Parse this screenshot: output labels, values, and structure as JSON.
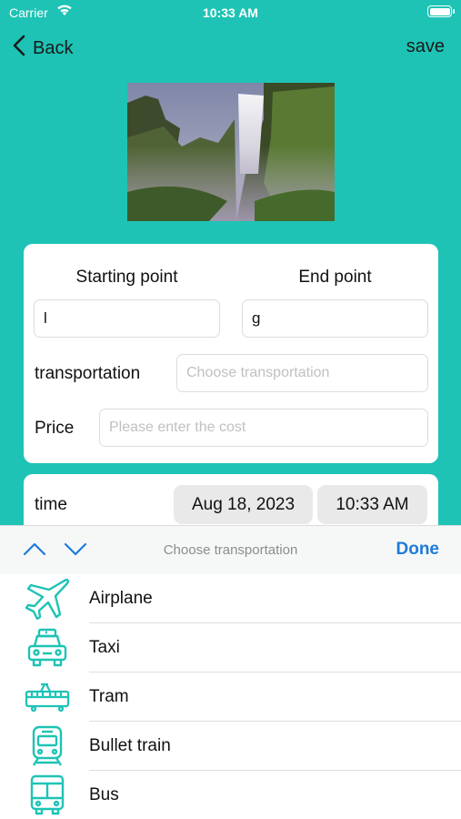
{
  "status_bar": {
    "carrier": "Carrier",
    "time": "10:33 AM"
  },
  "nav": {
    "back_label": "Back",
    "save_label": "save"
  },
  "form": {
    "start_label": "Starting point",
    "end_label": "End point",
    "start_value": "l",
    "end_value": "g",
    "transport_label": "transportation",
    "transport_placeholder": "Choose transportation",
    "price_label": "Price",
    "price_placeholder": "Please enter the cost",
    "time_label": "time",
    "date_value": "Aug 18, 2023",
    "time_value": "10:33 AM"
  },
  "picker": {
    "title": "Choose transportation",
    "done_label": "Done",
    "items": [
      {
        "label": "Airplane",
        "icon": "airplane-icon"
      },
      {
        "label": "Taxi",
        "icon": "taxi-icon"
      },
      {
        "label": "Tram",
        "icon": "tram-icon"
      },
      {
        "label": "Bullet train",
        "icon": "bullet-train-icon"
      },
      {
        "label": "Bus",
        "icon": "bus-icon"
      }
    ]
  },
  "colors": {
    "background": "#1ec3b5",
    "accent": "#1d7bd8",
    "icon": "#1ec3b5"
  }
}
